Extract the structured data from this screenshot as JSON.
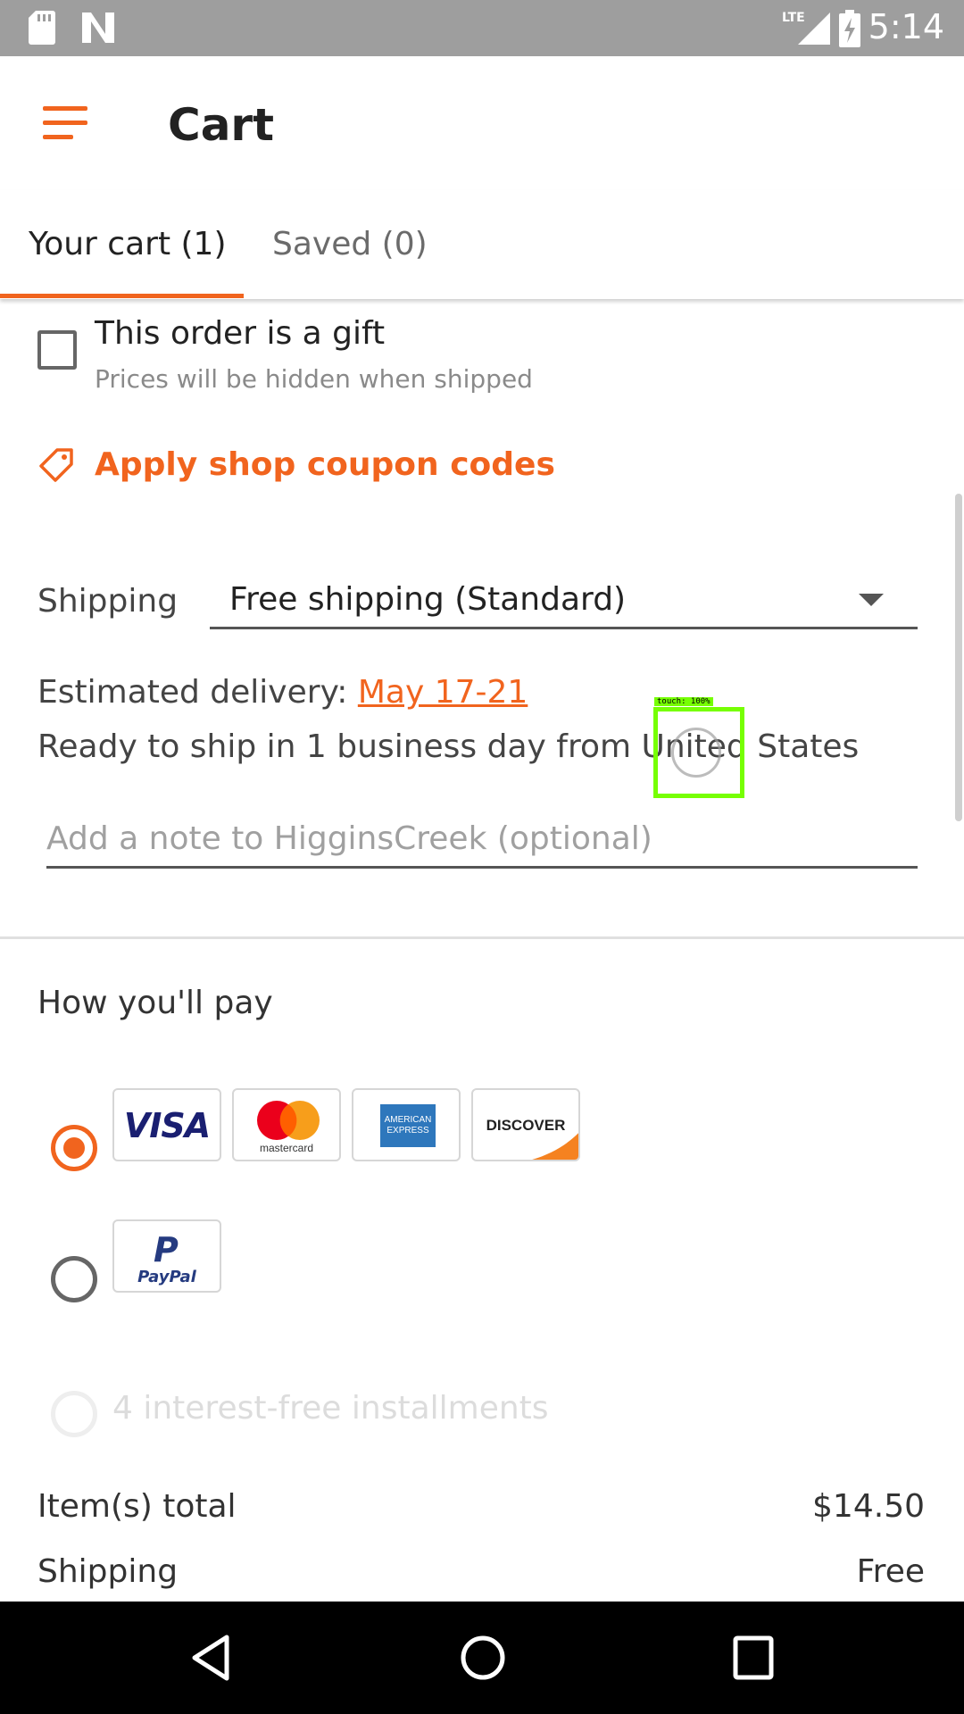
{
  "status_bar": {
    "time": "5:14",
    "network": "LTE",
    "icons": [
      "sd-card-icon",
      "n-notification-icon",
      "lte-signal-icon",
      "battery-charging-icon"
    ]
  },
  "app_bar": {
    "title": "Cart",
    "menu_icon": "hamburger-menu-icon"
  },
  "tabs": [
    {
      "label": "Your cart (1)",
      "selected": true
    },
    {
      "label": "Saved (0)",
      "selected": false
    }
  ],
  "gift": {
    "title": "This order is a gift",
    "subtitle": "Prices will be hidden when shipped",
    "checked": false
  },
  "coupon": {
    "label": "Apply shop coupon codes",
    "icon": "tag-icon"
  },
  "shipping": {
    "label": "Shipping",
    "selected_option": "Free shipping (Standard)"
  },
  "delivery": {
    "prefix": "Estimated delivery: ",
    "dates": "May 17-21",
    "ready": "Ready to ship in 1 business day from United States"
  },
  "note": {
    "placeholder": "Add a note to HigginsCreek (optional)"
  },
  "payment": {
    "title": "How you'll pay",
    "cards": [
      "VISA",
      "mastercard",
      "AMERICAN EXPRESS",
      "DISCOVER"
    ],
    "paypal_label": "PayPal",
    "paypal_mark": "P",
    "installments": "4 interest-free installments",
    "selected": "cards"
  },
  "summary": {
    "items_label": "Item(s) total",
    "items_value": "$14.50",
    "shipping_label": "Shipping",
    "shipping_value": "Free"
  },
  "touch_overlay": {
    "label": "touch: 100%"
  },
  "colors": {
    "accent": "#f1641e",
    "status_bar": "#9e9e9e",
    "nav_bar": "#000000",
    "touch": "#76ff03"
  }
}
